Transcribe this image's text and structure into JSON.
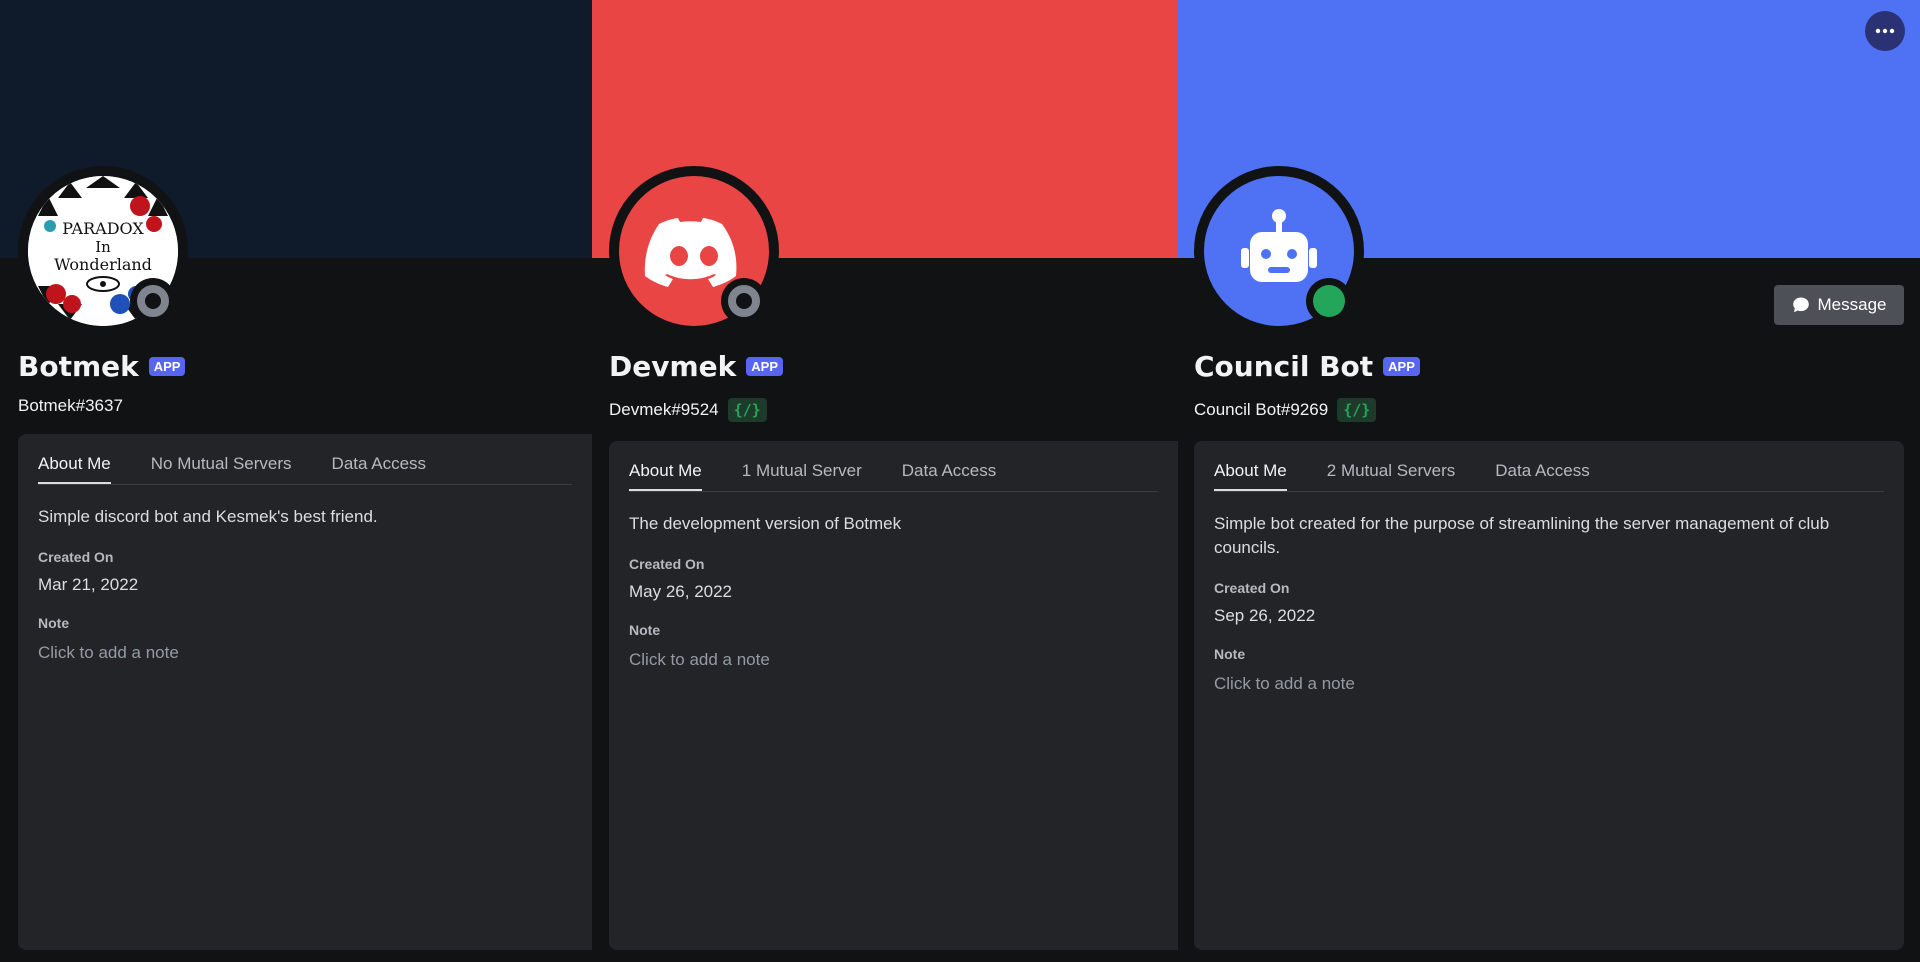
{
  "profiles": [
    {
      "name": "Botmek",
      "badge": "APP",
      "tag": "Botmek#3637",
      "banner_color": "#0f1a2a",
      "tabs": [
        "About Me",
        "No Mutual Servers",
        "Data Access"
      ],
      "bio": "Simple discord bot and Kesmek's best friend.",
      "created_label": "Created On",
      "created_value": "Mar 21, 2022",
      "note_label": "Note",
      "note_placeholder": "Click to add a note",
      "avatar_text": [
        "PARADOX",
        "In",
        "Wonderland"
      ],
      "status": "offline"
    },
    {
      "name": "Devmek",
      "badge": "APP",
      "tag": "Devmek#9524",
      "slash_badge": "{/}",
      "banner_color": "#ea4545",
      "tabs": [
        "About Me",
        "1 Mutual Server",
        "Data Access"
      ],
      "bio": "The development version of Botmek",
      "created_label": "Created On",
      "created_value": "May 26, 2022",
      "note_label": "Note",
      "note_placeholder": "Click to add a note",
      "status": "offline"
    },
    {
      "name": "Council Bot",
      "badge": "APP",
      "tag": "Council Bot#9269",
      "slash_badge": "{/}",
      "banner_color": "#4f72f5",
      "tabs": [
        "About Me",
        "2 Mutual Servers",
        "Data Access"
      ],
      "bio": "Simple bot created for the purpose of streamlining the server management of club councils.",
      "created_label": "Created On",
      "created_value": "Sep 26, 2022",
      "note_label": "Note",
      "note_placeholder": "Click to add a note",
      "status": "online"
    }
  ],
  "actions": {
    "message_label": "Message",
    "more_icon": "ellipsis-icon"
  },
  "colors": {
    "background": "#111214",
    "card": "#232428",
    "blurple": "#5865f2",
    "online": "#23a55a",
    "offline": "#80848e"
  }
}
